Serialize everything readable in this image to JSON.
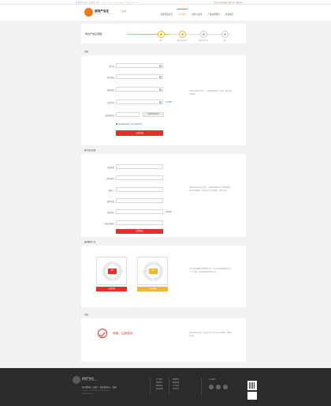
{
  "topbar": {
    "left_text": "全国领先的产品服务平台 · For Your Thoughts, We Focus",
    "right_prefix": "欢迎您来到 ",
    "login": "[登录]",
    "right_suffix": " 免费注册 | 收藏本站"
  },
  "header": {
    "logo_text": "捷旭产信证",
    "logo_sub": "Jiexu Industry Certificate",
    "city": "[天津]",
    "nav": [
      "首都页面首页",
      "个人中心",
      "新闻与资讯",
      "产品注册服务",
      "联系我们"
    ],
    "nav_active_index": 1
  },
  "progress": {
    "title": "申办产地证流程：",
    "steps": [
      "注册",
      "填写企业信息",
      "选择办理产品",
      "完成"
    ],
    "current_step": 2
  },
  "register": {
    "title": "注册",
    "fields": [
      {
        "label": "用户名：",
        "required": true,
        "placeholder": ""
      },
      {
        "label": "输入密码：",
        "required": true,
        "placeholder": ""
      },
      {
        "label": "确认密码：",
        "required": true,
        "placeholder": ""
      },
      {
        "label": "企业手机：",
        "required": true,
        "placeholder": ""
      },
      {
        "label": "短信验证码：",
        "required": true,
        "placeholder": ""
      }
    ],
    "mobile_link": "点击获取",
    "code_button": "获取短信验证码",
    "agree_text": "我已阅读并同意",
    "agree_link": "《用户注册协议书》",
    "submit": "立即注册",
    "aside": "欢迎您注册本平台账户，只需要简单填写几步信息，即可完成注册操作。"
  },
  "company": {
    "title": "填写企业信息",
    "fields": [
      {
        "label": "企业名称："
      },
      {
        "label": "工商注册号："
      },
      {
        "label": "联系人："
      },
      {
        "label": "联系电话："
      },
      {
        "label": "所在地区："
      },
      {
        "label": "产品证书编号："
      }
    ],
    "region_link": "选择地区",
    "submit": "立即提交",
    "aside": "请填写您的企业真实信息，以便我们能够及时与您取得联系，提供更好的服务。所有信息均会严格保密，请放心填写。"
  },
  "services": {
    "title": "选择服务产品",
    "items": [
      {
        "tag": "年检",
        "button": "立即办理",
        "color": "#e0322b"
      },
      {
        "tag": "新办",
        "button": "立即办理",
        "color": "#f0b72d"
      }
    ],
    "aside": "您可以选择需要办理的服务产品，点击立即办理按钮即可进入下一步流程。如有疑问请联系客服人员。"
  },
  "complete": {
    "title": "完成",
    "message": "恭喜，注册成功！",
    "aside": "您的注册已经完成，我们的工作人员会尽快与您联系，感谢您的支持。"
  },
  "footer": {
    "title": "捷旭产信证",
    "sub": "Jiexu Industry Certificate",
    "slogan": "用心服务每一位客户，助您事业更上一层楼",
    "copyright": "Copyright © 2016 捷旭产信证 All Rights Reserved",
    "icp": "津ICP备12345678号",
    "col1": [
      "关于我们",
      "联系我们",
      "服务流程",
      "常见问题"
    ],
    "col2": [
      "新闻资讯",
      "政策法规",
      "行业动态",
      "合作伙伴"
    ],
    "follow": "关注我们",
    "social_icons": [
      "weibo-icon",
      "wechat-icon",
      "qq-icon"
    ]
  }
}
